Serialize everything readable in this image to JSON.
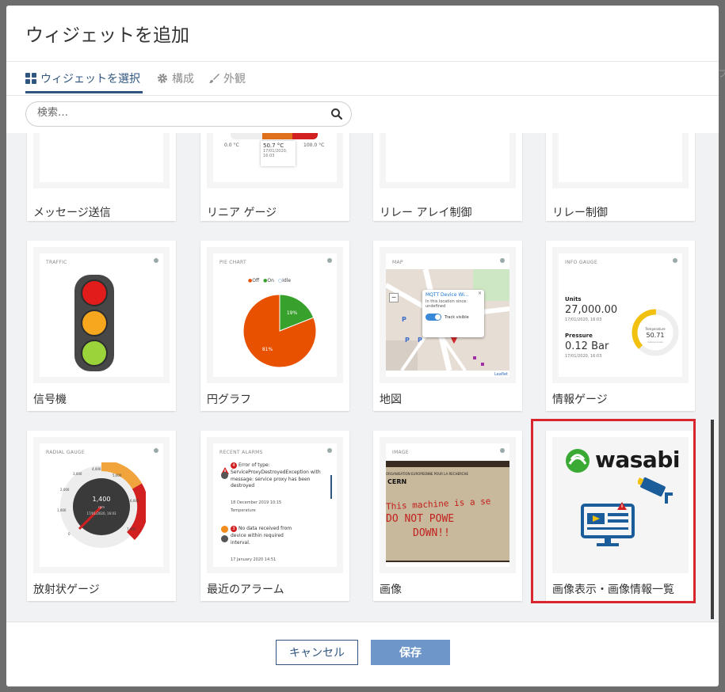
{
  "dialog": {
    "title": "ウィジェットを追加"
  },
  "tabs": [
    {
      "label": "ウィジェットを選択",
      "icon": "widgets-grid-icon",
      "active": true
    },
    {
      "label": "構成",
      "icon": "gear-icon",
      "active": false
    },
    {
      "label": "外観",
      "icon": "brush-icon",
      "active": false
    }
  ],
  "search": {
    "placeholder": "検索…",
    "value": ""
  },
  "widgets_row1": [
    {
      "label": "メッセージ送信"
    },
    {
      "label": "リニア ゲージ",
      "preview": {
        "min": "0.0 °C",
        "value": "50.7 °C",
        "max": "100.0 °C",
        "date": "17/01/2020,",
        "time": "16:03"
      }
    },
    {
      "label": "リレー アレイ制御"
    },
    {
      "label": "リレー制御"
    }
  ],
  "widgets_row2": [
    {
      "label": "信号機",
      "preview": {
        "title": "TRAFFIC"
      }
    },
    {
      "label": "円グラフ",
      "preview": {
        "title": "PIE CHART",
        "legend": [
          "Off",
          "On",
          "Idle"
        ],
        "slices": [
          {
            "name": "Off",
            "value": 81,
            "label": "81%",
            "color": "#e85100"
          },
          {
            "name": "On",
            "value": 19,
            "label": "19%",
            "color": "#37a12c"
          }
        ]
      }
    },
    {
      "label": "地図",
      "preview": {
        "title": "MAP",
        "popup_title": "MQTT Device Wi...",
        "popup_line1": "In this location since:",
        "popup_line2": "undefined",
        "toggle_label": "Track visible",
        "attribution": "Leaflet"
      }
    },
    {
      "label": "情報ゲージ",
      "preview": {
        "title": "INFO GAUGE",
        "units_label": "Units",
        "units_value": "27,000.00",
        "units_date": "17/01/2020, 16:03",
        "pressure_label": "Pressure",
        "pressure_value": "0.12 Bar",
        "pressure_date": "17/01/2020, 16:03",
        "temp_label": "Temperature",
        "temp_value": "50.71",
        "temp_unit": "Celsius scale",
        "temp_fraction": 0.5071
      }
    }
  ],
  "widgets_row3": [
    {
      "label": "放射状ゲージ",
      "preview": {
        "title": "RADIAL GAUGE",
        "value": "1,400",
        "unit": "rpm",
        "date": "17/01/2020, 16:03",
        "ticks": [
          "0",
          "1,000",
          "2,000",
          "3,000",
          "4,000",
          "5,000",
          "6,000",
          "7,000"
        ]
      }
    },
    {
      "label": "最近のアラーム",
      "preview": {
        "title": "RECENT ALARMS",
        "alarm1_count": "4",
        "alarm1_text1": "Error of type:",
        "alarm1_text2": "ServiceProxyDestroyedException with",
        "alarm1_text3": "message: service proxy has been",
        "alarm1_text4": "destroyed",
        "alarm1_date": "18 December 2019 10:15",
        "alarm1_source": "Temperature",
        "alarm2_count": "3",
        "alarm2_text1": "No data received from",
        "alarm2_text2": "device within required",
        "alarm2_text3": "interval.",
        "alarm2_date": "17 January 2020 14:51"
      }
    },
    {
      "label": "画像",
      "preview": {
        "title": "IMAGE",
        "photo_line1": "This machine is a se",
        "photo_line2": "DO NOT POWE",
        "photo_line3": "DOWN!!",
        "photo_header": "CERN",
        "photo_sub": "ORGANISATION EUROPEENNE POUR LA RECHERCHE"
      }
    },
    {
      "label": "画像表示・画像情報一覧",
      "preview": {
        "logo_text": "wasabi",
        "highlighted": true
      }
    }
  ],
  "footer": {
    "cancel_label": "キャンセル",
    "save_label": "保存"
  },
  "colors": {
    "accent": "#305680",
    "save_button": "#6f96c9",
    "highlight": "#d9252e",
    "wasabi_green": "#3aaa35",
    "monitor_blue": "#1b5d9b"
  }
}
